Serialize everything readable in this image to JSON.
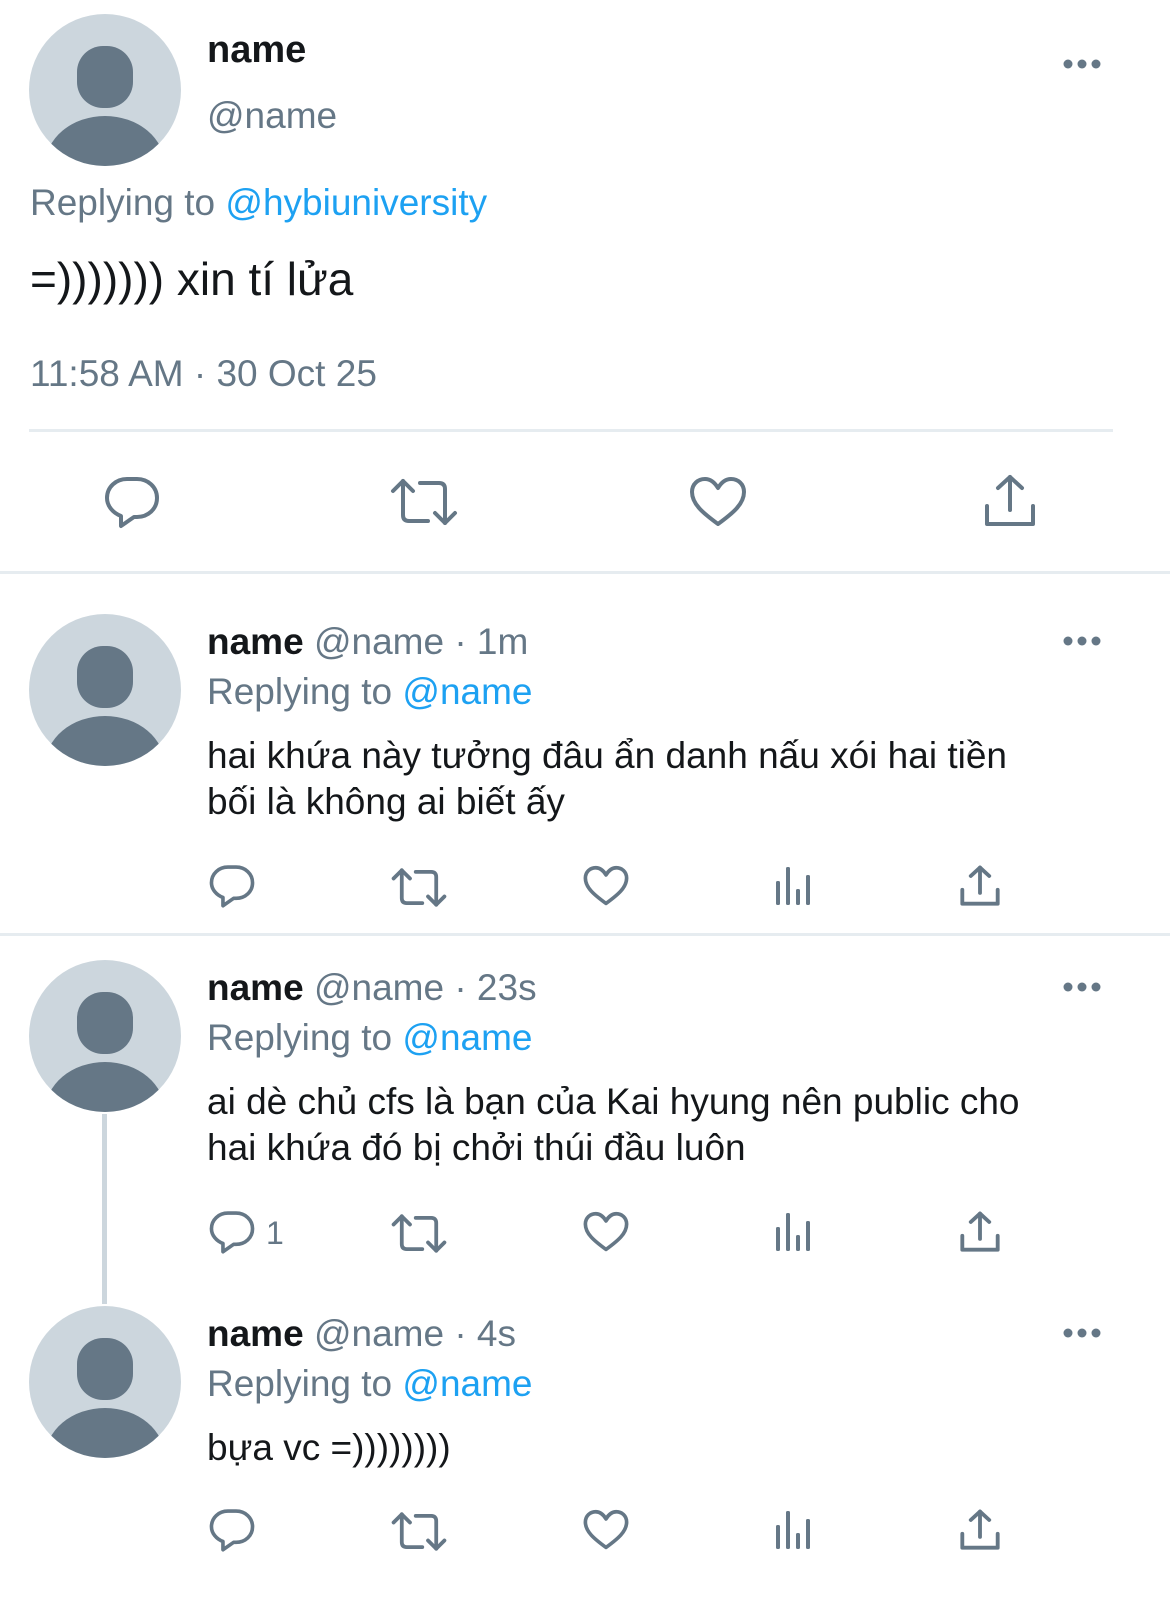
{
  "main_tweet": {
    "name": "name",
    "handle": "@name",
    "replying_prefix": "Replying to",
    "replying_to": "@hybiuniversity",
    "text": "=))))))) xin tí lửa",
    "timestamp": "11:58 AM · 30 Oct 25"
  },
  "replies": [
    {
      "name": "name",
      "meta": "@name · 1m",
      "replying_prefix": "Replying to",
      "replying_to": "@name",
      "text_line1": "hai khứa này tưởng đâu ẩn danh nấu xói hai tiền",
      "text_line2": "bối là không ai biết ấy",
      "reply_count": ""
    },
    {
      "name": "name",
      "meta": "@name · 23s",
      "replying_prefix": "Replying to",
      "replying_to": "@name",
      "text_line1": "ai dè chủ cfs là bạn của Kai hyung nên public cho",
      "text_line2": "hai khứa đó bị chởi thúi đầu luôn",
      "reply_count": "1"
    },
    {
      "name": "name",
      "meta": "@name · 4s",
      "replying_prefix": "Replying to",
      "replying_to": "@name",
      "text_line1": "bựa vc =))))))))",
      "text_line2": "",
      "reply_count": ""
    }
  ],
  "icons": {
    "reply": "speech-bubble-icon",
    "retweet": "retweet-icon",
    "like": "heart-icon",
    "analytics": "analytics-bars-icon",
    "share": "share-upload-icon",
    "more": "more-dots-icon",
    "avatar": "default-avatar-icon"
  },
  "colors": {
    "text": "#14171a",
    "secondary": "#657786",
    "link": "#1da1f2",
    "divider": "#e6ecf0",
    "avatar_bg": "#ccd6dd",
    "avatar_fg": "#657786"
  }
}
